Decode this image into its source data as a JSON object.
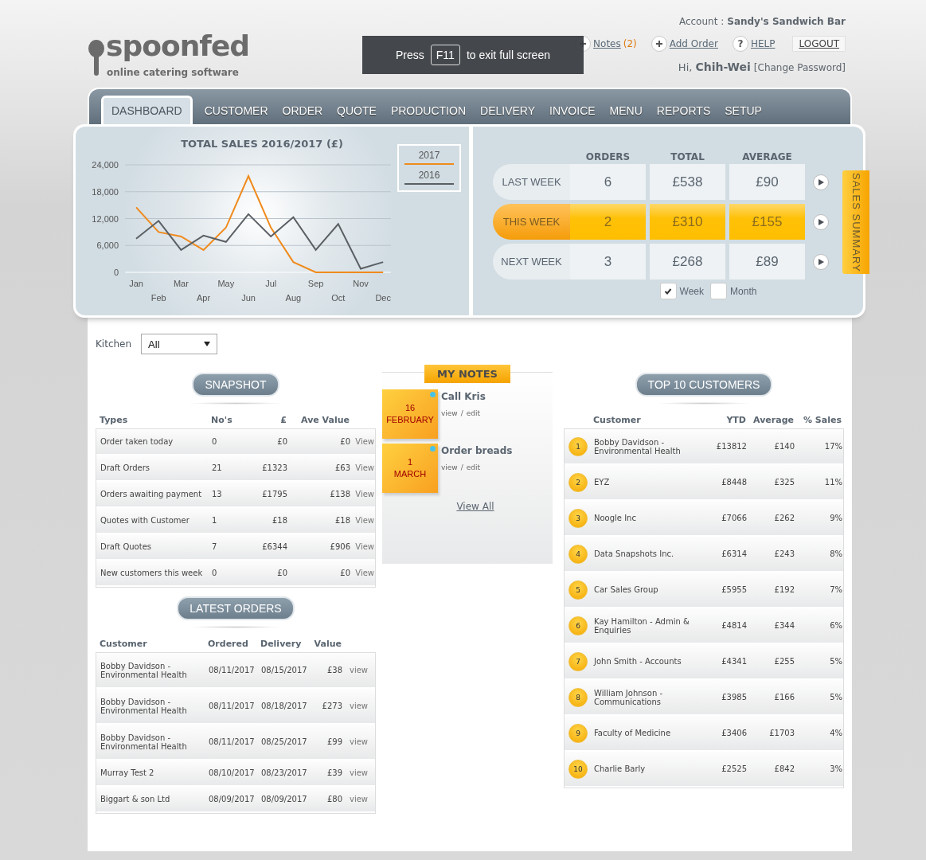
{
  "logo": {
    "name": "spoonfed",
    "tagline": "online catering software"
  },
  "account": {
    "label": "Account :",
    "value": "Sandy's Sandwich Bar"
  },
  "header_links": [
    {
      "kind": "plus",
      "label": "Notes",
      "count": "(2)"
    },
    {
      "kind": "plus",
      "label": "Add Order"
    },
    {
      "kind": "help",
      "glyph": "?",
      "label": "HELP"
    }
  ],
  "logout": "LOGOUT",
  "greeting": {
    "hi": "Hi,",
    "user": "Chih-Wei",
    "link": "[Change Password]"
  },
  "fullscreen_notice": {
    "before": "Press",
    "key": "F11",
    "after": "to exit full screen"
  },
  "tabs": [
    {
      "label": "DASHBOARD",
      "selected": true
    },
    {
      "label": "CUSTOMER",
      "selected": false
    },
    {
      "label": "ORDER",
      "selected": false
    },
    {
      "label": "QUOTE",
      "selected": false
    },
    {
      "label": "PRODUCTION",
      "selected": false
    },
    {
      "label": "DELIVERY",
      "selected": false
    },
    {
      "label": "INVOICE",
      "selected": false
    },
    {
      "label": "MENU",
      "selected": false
    },
    {
      "label": "REPORTS",
      "selected": false
    },
    {
      "label": "SETUP",
      "selected": false
    }
  ],
  "sales_chart": {
    "chart_data": {
      "type": "line",
      "grid": true,
      "title": "TOTAL SALES 2016/2017 (£)",
      "categories": [
        "Jan",
        "Feb",
        "Mar",
        "Apr",
        "May",
        "Jun",
        "Jul",
        "Aug",
        "Sep",
        "Oct",
        "Nov",
        "Dec"
      ],
      "ylim": [
        0,
        24000
      ],
      "yticks": [
        {
          "value": 0,
          "label": "0"
        },
        {
          "value": 6000,
          "label": "6,000"
        },
        {
          "value": 12000,
          "label": "12,000"
        },
        {
          "value": 18000,
          "label": "18,000"
        },
        {
          "value": 24000,
          "label": "24,000"
        }
      ],
      "series": [
        {
          "name": "2017",
          "color": "#f08a1c",
          "values": [
            14500,
            9000,
            8000,
            5000,
            10000,
            21500,
            10000,
            2300,
            0,
            0,
            0,
            0
          ]
        },
        {
          "name": "2016",
          "color": "#5a5f64",
          "values": [
            7500,
            11500,
            5000,
            8200,
            6800,
            13000,
            8000,
            12300,
            5000,
            10800,
            800,
            2300
          ]
        }
      ]
    }
  },
  "sales_summary": {
    "tab": "SALES SUMMARY",
    "columns": [
      "ORDERS",
      "TOTAL",
      "AVERAGE"
    ],
    "rows": [
      {
        "label": "LAST WEEK",
        "selected": false,
        "values": [
          "6",
          "£538",
          "£90"
        ]
      },
      {
        "label": "THIS WEEK",
        "selected": true,
        "values": [
          "2",
          "£310",
          "£155"
        ]
      },
      {
        "label": "NEXT WEEK",
        "selected": false,
        "values": [
          "3",
          "£268",
          "£89"
        ]
      }
    ],
    "options": [
      {
        "label": "Week",
        "checked": true
      },
      {
        "label": "Month",
        "checked": false
      }
    ]
  },
  "kitchen": {
    "label": "Kitchen",
    "value": "All"
  },
  "snapshot": {
    "title": "SNAPSHOT",
    "columns": [
      "Types",
      "No's",
      "£",
      "Ave Value"
    ],
    "rows": [
      {
        "type": "Order taken today",
        "count": "0",
        "total": "£0",
        "average": "£0",
        "link": "View"
      },
      {
        "type": "Draft Orders",
        "count": "21",
        "total": "£1323",
        "average": "£63",
        "link": "View"
      },
      {
        "type": "Orders awaiting payment",
        "count": "13",
        "total": "£1795",
        "average": "£138",
        "link": "View"
      },
      {
        "type": "Quotes with Customer",
        "count": "1",
        "total": "£18",
        "average": "£18",
        "link": "View"
      },
      {
        "type": "Draft Quotes",
        "count": "7",
        "total": "£6344",
        "average": "£906",
        "link": "View"
      },
      {
        "type": "New customers this week",
        "count": "0",
        "total": "£0",
        "average": "£0",
        "link": "View"
      }
    ]
  },
  "latest_orders": {
    "title": "LATEST ORDERS",
    "columns": [
      "Customer",
      "Ordered",
      "Delivery",
      "Value"
    ],
    "rows": [
      {
        "customer": "Bobby Davidson - Environmental Health",
        "ordered": "08/11/2017",
        "delivery": "08/15/2017",
        "value": "£38",
        "link": "view"
      },
      {
        "customer": "Bobby Davidson - Environmental Health",
        "ordered": "08/11/2017",
        "delivery": "08/18/2017",
        "value": "£273",
        "link": "view"
      },
      {
        "customer": "Bobby Davidson - Environmental Health",
        "ordered": "08/11/2017",
        "delivery": "08/25/2017",
        "value": "£99",
        "link": "view"
      },
      {
        "customer": "Murray Test 2",
        "ordered": "08/10/2017",
        "delivery": "08/23/2017",
        "value": "£39",
        "link": "view"
      },
      {
        "customer": "Biggart & son Ltd",
        "ordered": "08/09/2017",
        "delivery": "08/09/2017",
        "value": "£80",
        "link": "view"
      }
    ]
  },
  "my_notes": {
    "title": "MY NOTES",
    "notes": [
      {
        "day": "16",
        "month": "FEBRUARY",
        "title": "Call Kris",
        "view": "view",
        "separator": "/",
        "edit": "edit"
      },
      {
        "day": "1",
        "month": "MARCH",
        "title": "Order breads",
        "view": "view",
        "separator": "/",
        "edit": "edit"
      }
    ],
    "view_all": "View All"
  },
  "top_customers": {
    "title": "TOP 10 CUSTOMERS",
    "columns": [
      "Customer",
      "YTD",
      "Average",
      "% Sales"
    ],
    "rows": [
      {
        "rank": "1",
        "customer": "Bobby Davidson - Environmental Health",
        "ytd": "£13812",
        "average": "£140",
        "share": "17%"
      },
      {
        "rank": "2",
        "customer": "EYZ",
        "ytd": "£8448",
        "average": "£325",
        "share": "11%"
      },
      {
        "rank": "3",
        "customer": "Noogle Inc",
        "ytd": "£7066",
        "average": "£262",
        "share": "9%"
      },
      {
        "rank": "4",
        "customer": "Data Snapshots Inc.",
        "ytd": "£6314",
        "average": "£243",
        "share": "8%"
      },
      {
        "rank": "5",
        "customer": "Car Sales Group",
        "ytd": "£5955",
        "average": "£192",
        "share": "7%"
      },
      {
        "rank": "6",
        "customer": "Kay Hamilton - Admin & Enquiries",
        "ytd": "£4814",
        "average": "£344",
        "share": "6%"
      },
      {
        "rank": "7",
        "customer": "John Smith - Accounts",
        "ytd": "£4341",
        "average": "£255",
        "share": "5%"
      },
      {
        "rank": "8",
        "customer": "William Johnson - Communications",
        "ytd": "£3985",
        "average": "£166",
        "share": "5%"
      },
      {
        "rank": "9",
        "customer": "Faculty of Medicine",
        "ytd": "£3406",
        "average": "£1703",
        "share": "4%"
      },
      {
        "rank": "10",
        "customer": "Charlie Barly",
        "ytd": "£2525",
        "average": "£842",
        "share": "3%"
      }
    ]
  }
}
